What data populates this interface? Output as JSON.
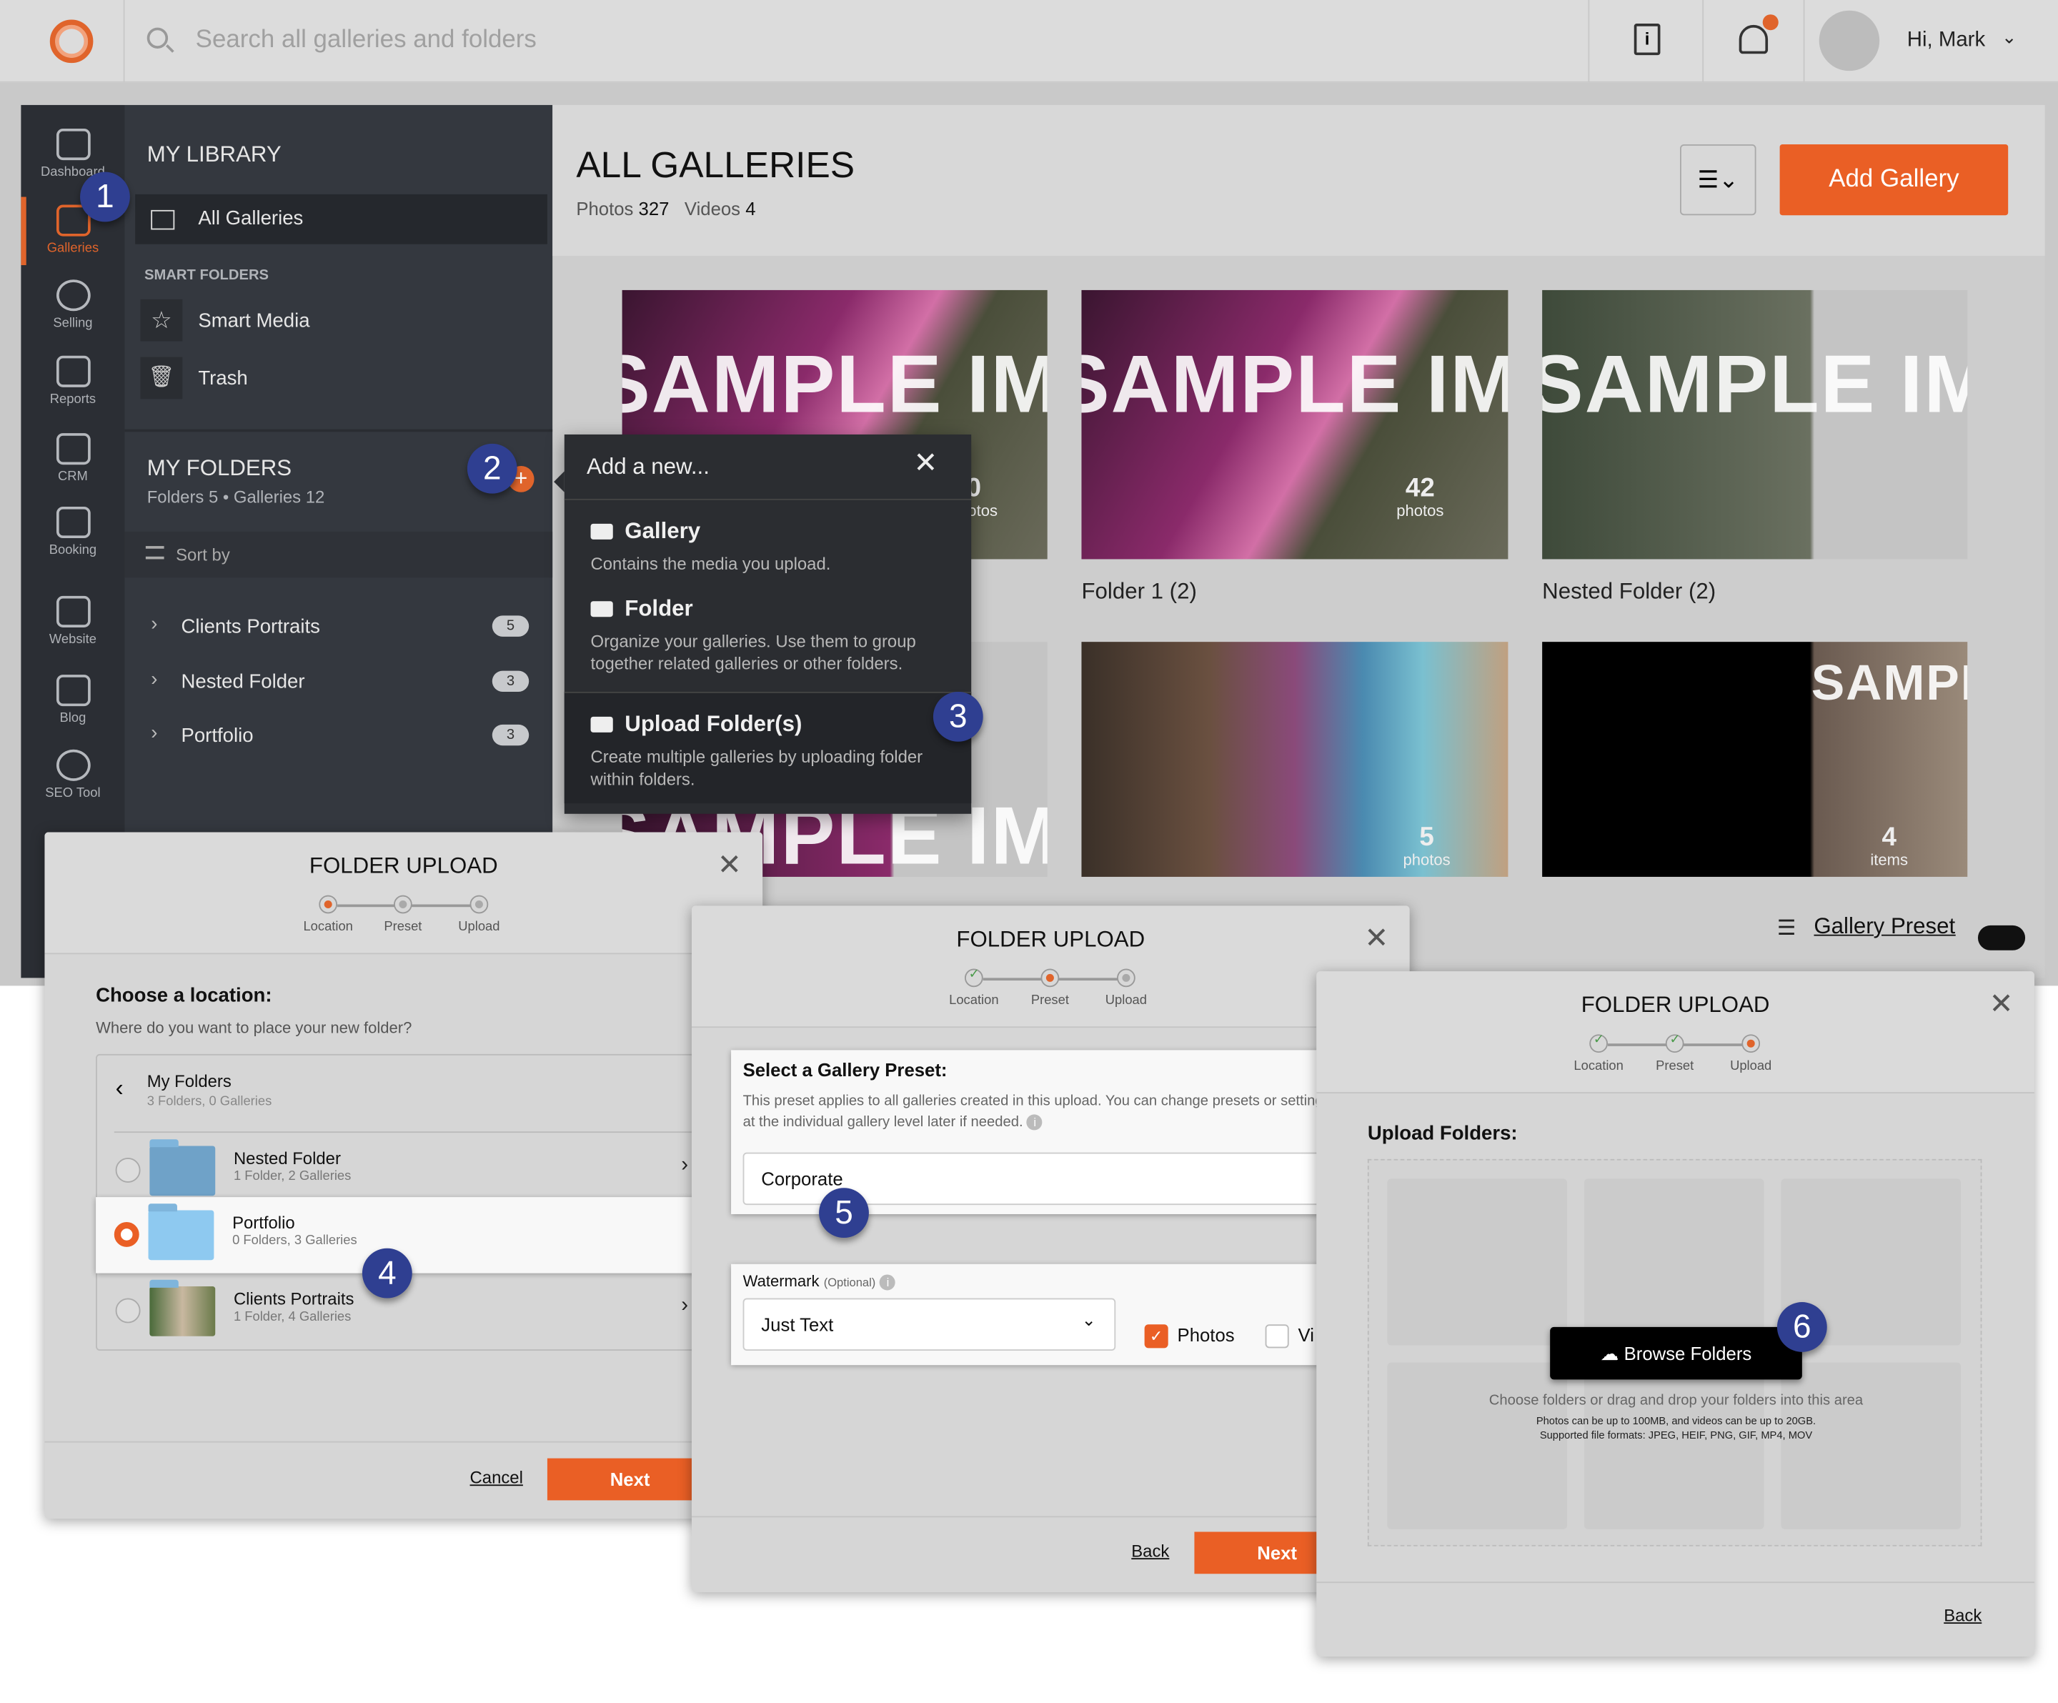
{
  "topbar": {
    "search_placeholder": "Search all galleries and folders",
    "greeting": "Hi, Mark",
    "icons": [
      "logo",
      "search-icon",
      "help-book-icon",
      "bell-icon",
      "avatar",
      "chevron-down-icon"
    ],
    "notification_dot_color": "#e0642b"
  },
  "leftnav": {
    "items": [
      {
        "label": "Dashboard",
        "icon": "gauge-icon"
      },
      {
        "label": "Galleries",
        "icon": "image-icon",
        "active": true
      },
      {
        "label": "Selling",
        "icon": "dollar-icon"
      },
      {
        "label": "Reports",
        "icon": "bar-chart-icon"
      },
      {
        "label": "CRM",
        "icon": "paper-plane-icon"
      },
      {
        "label": "Booking",
        "icon": "calendar-icon"
      },
      {
        "label": "Website",
        "icon": "website-icon"
      },
      {
        "label": "Blog",
        "icon": "blog-icon"
      },
      {
        "label": "SEO Tool",
        "icon": "globe-search-icon"
      }
    ]
  },
  "library": {
    "title": "MY LIBRARY",
    "all_galleries": "All Galleries",
    "smart_folders_title": "SMART FOLDERS",
    "smart_media": "Smart Media",
    "trash": "Trash",
    "my_folders_title": "MY FOLDERS",
    "my_folders_sub": "Folders 5 • Galleries 12",
    "sort_by": "Sort by",
    "folders": [
      {
        "name": "Clients Portraits",
        "count": "5"
      },
      {
        "name": "Nested Folder",
        "count": "3"
      },
      {
        "name": "Portfolio",
        "count": "3"
      }
    ]
  },
  "main": {
    "title": "ALL GALLERIES",
    "photos_label": "Photos",
    "photos_count": "327",
    "videos_label": "Videos",
    "videos_count": "4",
    "add_gallery": "Add Gallery",
    "gallery_presets": "Gallery Presets",
    "sample_text": "SAMPLE IMAGE",
    "galleries": [
      {
        "count": "0",
        "unit": "photos",
        "label": ""
      },
      {
        "count": "42",
        "unit": "photos",
        "label": "Folder 1 (2)"
      },
      {
        "count": "",
        "unit": "",
        "label": "Nested Folder (2)"
      },
      {
        "count": "",
        "unit": "",
        "label": ""
      },
      {
        "count": "5",
        "unit": "photos",
        "label": ""
      },
      {
        "count": "4",
        "unit": "items",
        "label": ""
      }
    ]
  },
  "popup": {
    "title": "Add a new...",
    "items": [
      {
        "title": "Gallery",
        "desc": "Contains the media you upload."
      },
      {
        "title": "Folder",
        "desc": "Organize your galleries. Use them to group together related galleries or other folders."
      },
      {
        "title": "Upload Folder(s)",
        "desc": "Create multiple galleries by uploading folder within folders."
      }
    ]
  },
  "steps": [
    "Location",
    "Preset",
    "Upload"
  ],
  "modal1": {
    "title": "FOLDER UPLOAD",
    "heading": "Choose a location:",
    "subheading": "Where do you want to place your new folder?",
    "parent": {
      "name": "My Folders",
      "sub": "3 Folders, 0 Galleries"
    },
    "folders": [
      {
        "name": "Nested Folder",
        "sub": "1 Folder, 2 Galleries",
        "selected": false
      },
      {
        "name": "Portfolio",
        "sub": "0 Folders, 3 Galleries",
        "selected": true
      },
      {
        "name": "Clients Portraits",
        "sub": "1 Folder, 4 Galleries",
        "selected": false
      }
    ],
    "cancel": "Cancel",
    "next": "Next"
  },
  "modal2": {
    "title": "FOLDER UPLOAD",
    "preset_heading": "Select a Gallery Preset:",
    "preset_desc": "This preset applies to all galleries created in this upload. You can change presets or settings at the individual gallery level later if needed.",
    "preset_value": "Corporate",
    "watermark_label": "Watermark",
    "watermark_optional": "(Optional)",
    "watermark_value": "Just Text",
    "photos_label": "Photos",
    "photos_checked": true,
    "videos_label": "Vi",
    "videos_checked": false,
    "back": "Back",
    "next": "Next"
  },
  "modal3": {
    "title": "FOLDER UPLOAD",
    "heading": "Upload Folders:",
    "browse": "Browse Folders",
    "hint": "Choose folders or drag and drop your folders into this area",
    "limits": "Photos can be up to 100MB, and videos can be up to 20GB.",
    "formats": "Supported file formats: JPEG, HEIF, PNG, GIF, MP4, MOV",
    "back": "Back"
  },
  "badges": [
    "1",
    "2",
    "3",
    "4",
    "5",
    "6"
  ],
  "colors": {
    "accent": "#ea5f25",
    "badge": "#2f3f91",
    "sidebar": "#2b2e34"
  }
}
